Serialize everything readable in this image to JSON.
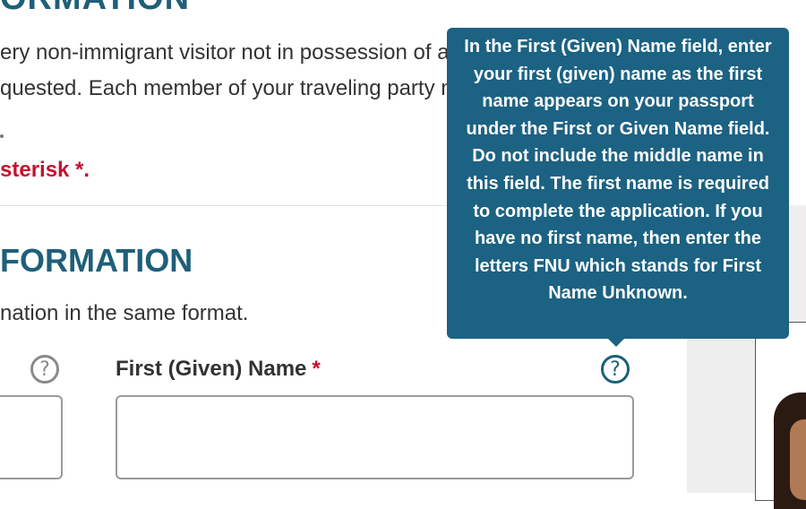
{
  "page": {
    "top_heading": "ORMATION",
    "intro_line_1": "ery non-immigrant visitor not in possession of a visitor's visa who is a national",
    "intro_line_2": "quested. Each member of your traveling party must complete a separate app",
    "required_note": "sterisk *.",
    "section_heading": "FORMATION",
    "section_subtext": "nation in the same format."
  },
  "field": {
    "label": "First (Given) Name",
    "required_marker": "*",
    "value": "",
    "left_input_value": ""
  },
  "help": {
    "icon_glyph": "?"
  },
  "tooltip": {
    "text": "In the First (Given) Name field, enter your first (given) name as the first name appears on your passport under the First or Given Name field. Do not include the middle name in this field. The first name is required to complete the application. If you have no first name, then enter the letters FNU which stands for First Name Unknown."
  },
  "colors": {
    "heading": "#1f5f7a",
    "required": "#c8102e",
    "tooltip_bg": "#1c6282",
    "help_active": "#1c5f7b",
    "help_inactive": "#8a8a8a"
  }
}
